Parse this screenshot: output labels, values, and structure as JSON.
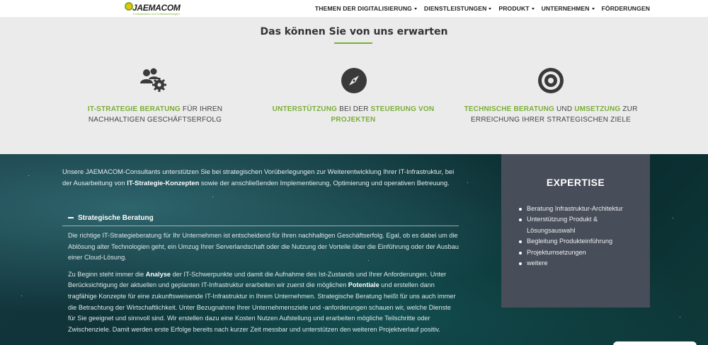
{
  "header": {
    "logo_text": "JAEMACOM",
    "logo_tagline": "It-Infrastruktur und Softwarelösungen",
    "nav": [
      {
        "label": "THEMEN DER DIGITALISIERUNG",
        "dropdown": true
      },
      {
        "label": "DIENSTLEISTUNGEN",
        "dropdown": true
      },
      {
        "label": "PRODUKT",
        "dropdown": true
      },
      {
        "label": "UNTERNEHMEN",
        "dropdown": true
      },
      {
        "label": "FÖRDERUNGEN",
        "dropdown": false
      }
    ]
  },
  "intro": {
    "title": "Das können Sie von uns erwarten",
    "features": [
      {
        "icon": "users-gear-icon",
        "hl1": "IT-STRATEGIE BERATUNG",
        "t1": " FÜR IHREN NACHHALTIGEN GESCHÄFTSERFOLG",
        "hl2": "",
        "t2": ""
      },
      {
        "icon": "compass-icon",
        "hl1": "UNTERSTÜTZUNG",
        "t1": " BEI DER ",
        "hl2": "STEUERUNG VON PROJEKTEN",
        "t2": ""
      },
      {
        "icon": "target-icon",
        "hl1": "TECHNISCHE BERATUNG",
        "t1": " UND ",
        "hl2": "UMSETZUNG",
        "t2": " ZUR ERREICHUNG IHRER STRATEGISCHEN ZIELE"
      }
    ]
  },
  "main": {
    "intro_before": "Unsere JAEMACOM-Consultants unterstützen Sie bei strategischen Vorüberlegungen zur Weiterentwicklung Ihrer IT-Infrastruktur, bei der Ausarbeitung von ",
    "intro_bold": "IT-Strategie-Konzepten",
    "intro_after": " sowie der anschließenden Implementierung, Optimierung und operativen Betreuung.",
    "accordion_title": "Strategische Beratung",
    "p1": "Die richtige IT-Strategieberatung für Ihr Unternehmen ist entscheidend für Ihren nachhaltigen Geschäftserfolg. Egal, ob es dabei um die Ablösung alter Technologien geht, ein Umzug Ihrer Serverlandschaft oder die Nutzung der Vorteile über die Einführung oder der Ausbau einer Cloud-Lösung.",
    "p2_a": "Zu Beginn steht immer die ",
    "p2_b1": "Analyse",
    "p2_c": " der IT-Schwerpunkte und damit die Aufnahme des Ist-Zustands und Ihrer Anforderungen. Unter Berücksichtigung der aktuellen und geplanten IT-Infrastruktur erarbeiten wir zuerst die möglichen ",
    "p2_b2": "Potentiale",
    "p2_d": " und erstellen dann tragfähige Konzepte für eine zukunftsweisende IT-Infrastruktur in Ihrem Unternehmen. Strategische Beratung heißt für uns auch immer die Betrachtung der Wirtschaftlichkeit. Unter Bezugnahme Ihrer Unternehmensziele und -anforderungen schauen wir, welche Dienste für Sie geeignet und sinnvoll sind. Wir erstellen dazu eine Kosten Nutzen Aufstellung und erarbeiten mögliche Teilschritte oder Zwischenziele. Damit werden erste Erfolge bereits nach kurzer Zeit messbar und unterstützen den weiteren Projektverlauf positiv."
  },
  "expertise": {
    "title": "EXPERTISE",
    "items": [
      "Beratung Infrastruktur-Architektur",
      "Unterstützung Produkt & Lösungsauswahl",
      "Begleitung Produkteinführung",
      "Projektumsetzungen",
      "weitere"
    ]
  },
  "colors": {
    "accent": "#7aae38",
    "panel": "#474d59",
    "dark_bg": "#0d3236"
  }
}
